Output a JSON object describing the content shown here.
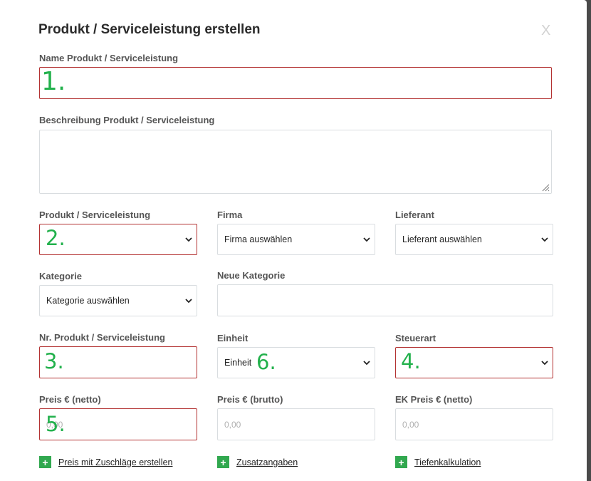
{
  "dialog": {
    "title": "Produkt / Serviceleistung erstellen",
    "close_label": "X"
  },
  "fields": {
    "name": {
      "label": "Name Produkt / Serviceleistung",
      "value": ""
    },
    "description": {
      "label": "Beschreibung Produkt / Serviceleistung",
      "value": ""
    },
    "product_type": {
      "label": "Produkt / Serviceleistung",
      "selected": ""
    },
    "company": {
      "label": "Firma",
      "selected": "Firma auswählen"
    },
    "supplier": {
      "label": "Lieferant",
      "selected": "Lieferant auswählen"
    },
    "category": {
      "label": "Kategorie",
      "selected": "Kategorie auswählen"
    },
    "new_category": {
      "label": "Neue Kategorie",
      "value": ""
    },
    "product_number": {
      "label": "Nr. Produkt / Serviceleistung",
      "value": ""
    },
    "unit": {
      "label": "Einheit",
      "selected": "Einheit"
    },
    "tax_type": {
      "label": "Steuerart",
      "selected": ""
    },
    "price_net": {
      "label": "Preis € (netto)",
      "placeholder": "0,00"
    },
    "price_gross": {
      "label": "Preis € (brutto)",
      "placeholder": "0,00"
    },
    "purchase_price_net": {
      "label": "EK Preis € (netto)",
      "placeholder": "0,00"
    }
  },
  "annotations": {
    "n1": "1.",
    "n2": "2.",
    "n3": "3.",
    "n4": "4.",
    "n5": "5.",
    "n6": "6."
  },
  "links": {
    "surcharge": "Preis mit Zuschläge erstellen",
    "additional": "Zusatzangaben",
    "deep_calc": "Tiefenkalkulation",
    "plus_icon": "+"
  },
  "colors": {
    "error_border": "#b33232",
    "annotation_green": "#22b14c",
    "plus_green": "#31a84f"
  }
}
